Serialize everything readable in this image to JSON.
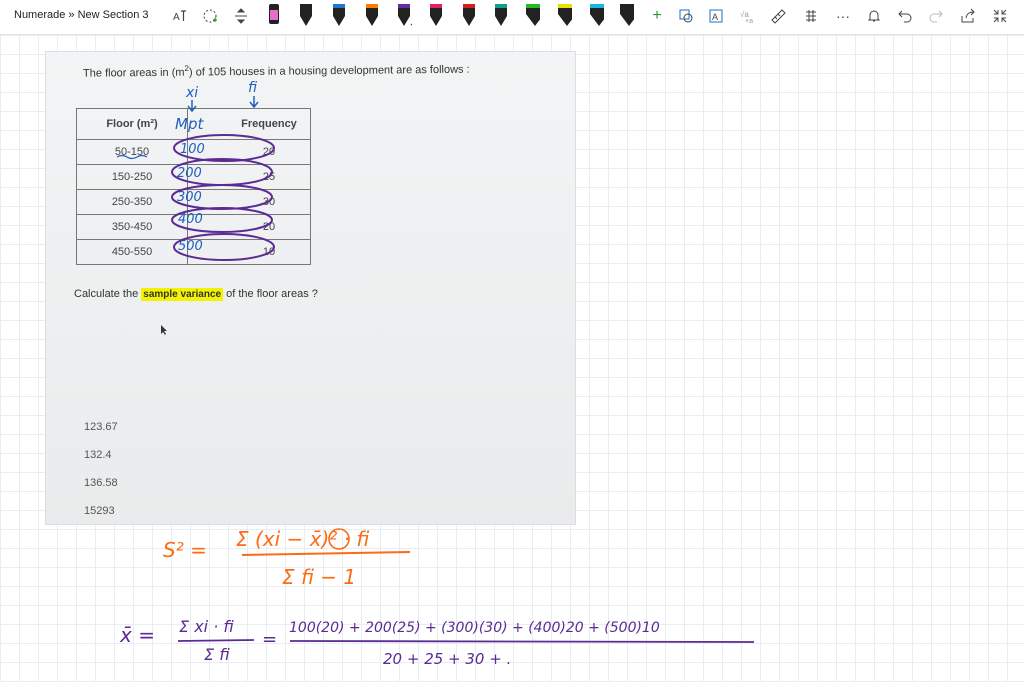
{
  "toolbar": {
    "breadcrumb": "Numerade » New Section 3",
    "tools": [
      "lasso-icon",
      "shape-icon",
      "add-space-icon"
    ],
    "pens": [
      {
        "name": "pen-black",
        "color": "#1a1a1a"
      },
      {
        "name": "pen-black-2",
        "color": "#1a1a1a"
      },
      {
        "name": "pen-blue",
        "color": "#2277cc"
      },
      {
        "name": "pen-orange",
        "color": "#ff7a00"
      },
      {
        "name": "pen-purple",
        "color": "#6a2aa8"
      },
      {
        "name": "pen-pink",
        "color": "#e0245e"
      },
      {
        "name": "pen-red",
        "color": "#d62020"
      },
      {
        "name": "pen-teal",
        "color": "#10a090"
      },
      {
        "name": "pen-green",
        "color": "#22bb22"
      },
      {
        "name": "pen-yellow",
        "color": "#e8e000"
      },
      {
        "name": "pen-cyan",
        "color": "#19b8e0"
      },
      {
        "name": "pen-dark",
        "color": "#222222"
      }
    ],
    "right_icons": [
      "add-pen-icon",
      "ink-to-shape-icon",
      "ink-to-text-icon",
      "ink-to-math-icon",
      "ruler-icon",
      "replay-icon",
      "more-icon",
      "notifications-icon",
      "undo-icon",
      "redo-icon",
      "share-icon",
      "fullscreen-icon"
    ]
  },
  "question": {
    "text_pre": "The floor areas in (m",
    "text_sup": "2",
    "text_post": ") of 105 houses in a housing development  are as follows :",
    "table": {
      "headers": [
        "Floor (m²)",
        "Frequency"
      ],
      "rows": [
        [
          "50-150",
          "20"
        ],
        [
          "150-250",
          "25"
        ],
        [
          "250-350",
          "30"
        ],
        [
          "350-450",
          "20"
        ],
        [
          "450-550",
          "10"
        ]
      ]
    },
    "calc_pre": "Calculate the ",
    "calc_highlight": "sample variance",
    "calc_post": " of the floor areas ?",
    "options": [
      "123.67",
      "132.4",
      "136.58",
      "15293"
    ]
  },
  "ink": {
    "xi_label": "xi",
    "fi_label": "fi",
    "mpt_label": "Mpt",
    "midpoints": [
      "100",
      "200",
      "300",
      "400",
      "500"
    ],
    "s2_lhs": "S² =",
    "s2_numerator": "Σ (xi − x̄)² · fi",
    "s2_denominator": "Σ fi − 1",
    "xbar_lhs": "x̄ =",
    "xbar_frac_num": "Σ xi · fi",
    "xbar_frac_den": "Σ fi",
    "xbar_equals": "=",
    "xbar_expansion": "100(20) + 200(25) + (300)(30) + (400)20 + (500)10",
    "xbar_den_sum": "20 + 25 + 30 + ."
  }
}
